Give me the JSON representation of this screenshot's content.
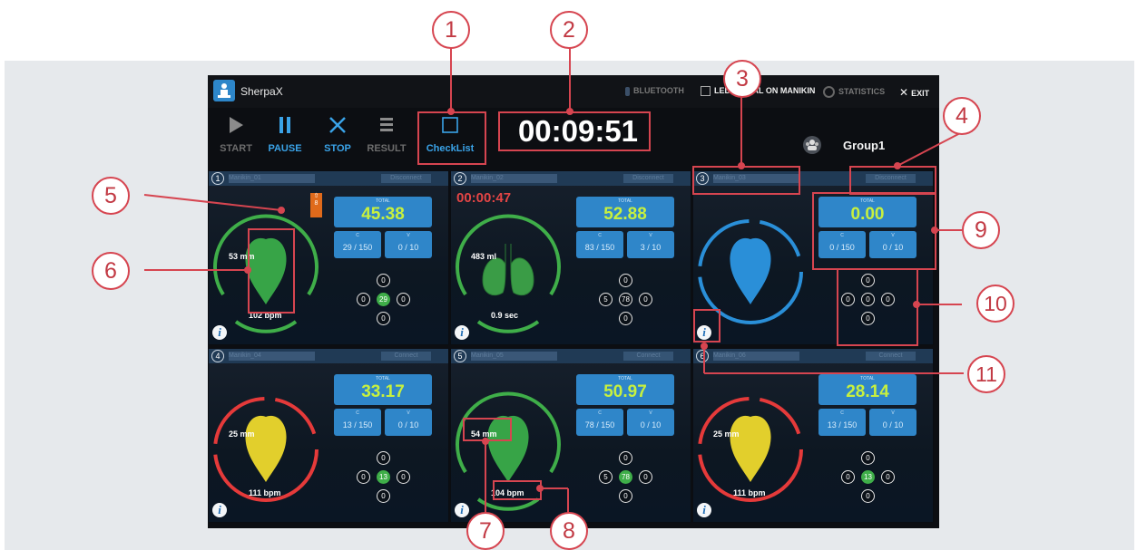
{
  "app": {
    "title": "SherpaX",
    "topbar": {
      "bluetooth": "BLUETOOTH",
      "led_checkbox": "LED SIGNAL ON MANIKIN",
      "statistics": "STATISTICS",
      "exit": "EXIT"
    },
    "toolbar": {
      "start": "START",
      "pause": "PAUSE",
      "stop": "STOP",
      "result": "RESULT",
      "checklist": "CheckList"
    },
    "timer": "00:09:51",
    "group": "Group1",
    "colors": {
      "accent_blue": "#2f86c9",
      "total_green": "#c7f03f",
      "ring_green": "#3fae49",
      "ring_red": "#e53a3a",
      "ring_blue": "#2a8fd8",
      "callout": "#d64550"
    }
  },
  "cells": [
    {
      "num": "1",
      "name": "Manikin_01",
      "tag": "Disconnect",
      "mode": "heart",
      "heart_color": "green",
      "ring_color": "green",
      "top_measure": "53 mm",
      "bottom_measure": "102 bpm",
      "total_label": "TOTAL",
      "total": "45.38",
      "c_label": "C",
      "c_value": "29 / 150",
      "v_label": "V",
      "v_value": "0 / 10",
      "dots": {
        "top": "0",
        "left": "0",
        "center": "29",
        "right": "0",
        "bottom": "0"
      },
      "center_green": true,
      "alert": "8",
      "elapsed": "",
      "icon": "heart-icon"
    },
    {
      "num": "2",
      "name": "Manikin_02",
      "tag": "Disconnect",
      "mode": "lungs",
      "heart_color": "green",
      "ring_color": "green",
      "top_measure": "483 ml",
      "bottom_measure": "0.9 sec",
      "total_label": "TOTAL",
      "total": "52.88",
      "c_label": "C",
      "c_value": "83 / 150",
      "v_label": "V",
      "v_value": "3 / 10",
      "dots": {
        "top": "0",
        "left": "5",
        "center": "78",
        "right": "0",
        "bottom": "0"
      },
      "center_green": false,
      "alert": "",
      "elapsed": "00:00:47",
      "icon": "lungs-icon"
    },
    {
      "num": "3",
      "name": "Manikin_03",
      "tag": "Disconnect",
      "mode": "heart",
      "heart_color": "blue",
      "ring_color": "blue",
      "top_measure": "",
      "bottom_measure": "",
      "total_label": "TOTAL",
      "total": "0.00",
      "c_label": "C",
      "c_value": "0 / 150",
      "v_label": "V",
      "v_value": "0 / 10",
      "dots": {
        "top": "0",
        "left": "0",
        "center": "0",
        "right": "0",
        "bottom": "0"
      },
      "center_green": false,
      "alert": "",
      "elapsed": "",
      "icon": "heart-icon"
    },
    {
      "num": "4",
      "name": "Manikin_04",
      "tag": "Connect",
      "mode": "heart",
      "heart_color": "yellow",
      "ring_color": "red",
      "top_measure": "25 mm",
      "bottom_measure": "111 bpm",
      "total_label": "TOTAL",
      "total": "33.17",
      "c_label": "C",
      "c_value": "13 / 150",
      "v_label": "V",
      "v_value": "0 / 10",
      "dots": {
        "top": "0",
        "left": "0",
        "center": "13",
        "right": "0",
        "bottom": "0"
      },
      "center_green": true,
      "alert": "",
      "elapsed": "",
      "icon": "heart-icon"
    },
    {
      "num": "5",
      "name": "Manikin_05",
      "tag": "Connect",
      "mode": "heart",
      "heart_color": "green",
      "ring_color": "green",
      "top_measure": "54 mm",
      "bottom_measure": "104 bpm",
      "total_label": "TOTAL",
      "total": "50.97",
      "c_label": "C",
      "c_value": "78 / 150",
      "v_label": "V",
      "v_value": "0 / 10",
      "dots": {
        "top": "0",
        "left": "5",
        "center": "78",
        "right": "0",
        "bottom": "0"
      },
      "center_green": true,
      "alert": "",
      "elapsed": "",
      "icon": "heart-icon"
    },
    {
      "num": "6",
      "name": "Manikin_06",
      "tag": "Connect",
      "mode": "heart",
      "heart_color": "yellow",
      "ring_color": "red",
      "top_measure": "25 mm",
      "bottom_measure": "111 bpm",
      "total_label": "TOTAL",
      "total": "28.14",
      "c_label": "C",
      "c_value": "13 / 150",
      "v_label": "V",
      "v_value": "0 / 10",
      "dots": {
        "top": "0",
        "left": "0",
        "center": "13",
        "right": "0",
        "bottom": "0"
      },
      "center_green": true,
      "alert": "",
      "elapsed": "",
      "icon": "heart-icon"
    }
  ],
  "callouts": [
    "1",
    "2",
    "3",
    "4",
    "5",
    "6",
    "7",
    "8",
    "9",
    "10",
    "11"
  ]
}
